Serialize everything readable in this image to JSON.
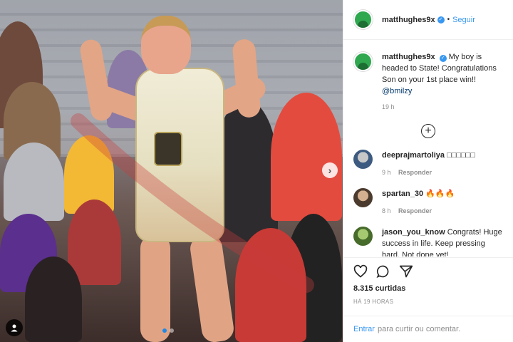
{
  "photo": {
    "nav_next": "›",
    "carousel": {
      "count": 2,
      "active": 1
    }
  },
  "header": {
    "username": "matthughes9x",
    "separator": "•",
    "follow_label": "Seguir"
  },
  "caption": {
    "username": "matthughes9x",
    "text": "My boy is headed to State! Congratulations Son on your 1st place win!! ",
    "mention": "@bmilzy",
    "time": "19 h"
  },
  "comments": [
    {
      "username": "deeprajmartoliya",
      "text": "□□□□□□",
      "time": "9 h",
      "reply": "Responder"
    },
    {
      "username": "spartan_30",
      "text": "🔥🔥🔥",
      "time": "8 h",
      "reply": "Responder"
    },
    {
      "username": "jason_you_know",
      "text": "Congrats! Huge success in life. Keep pressing hard. Not done yet!",
      "time": "",
      "reply": ""
    }
  ],
  "stats": {
    "likes": "8.315 curtidas",
    "posted_ago": "HÁ 19 HORAS"
  },
  "login": {
    "link": "Entrar",
    "text": "para curtir ou comentar."
  },
  "colors": {
    "accent": "#3897f0",
    "muted": "#8e8e8e",
    "text": "#262626"
  }
}
